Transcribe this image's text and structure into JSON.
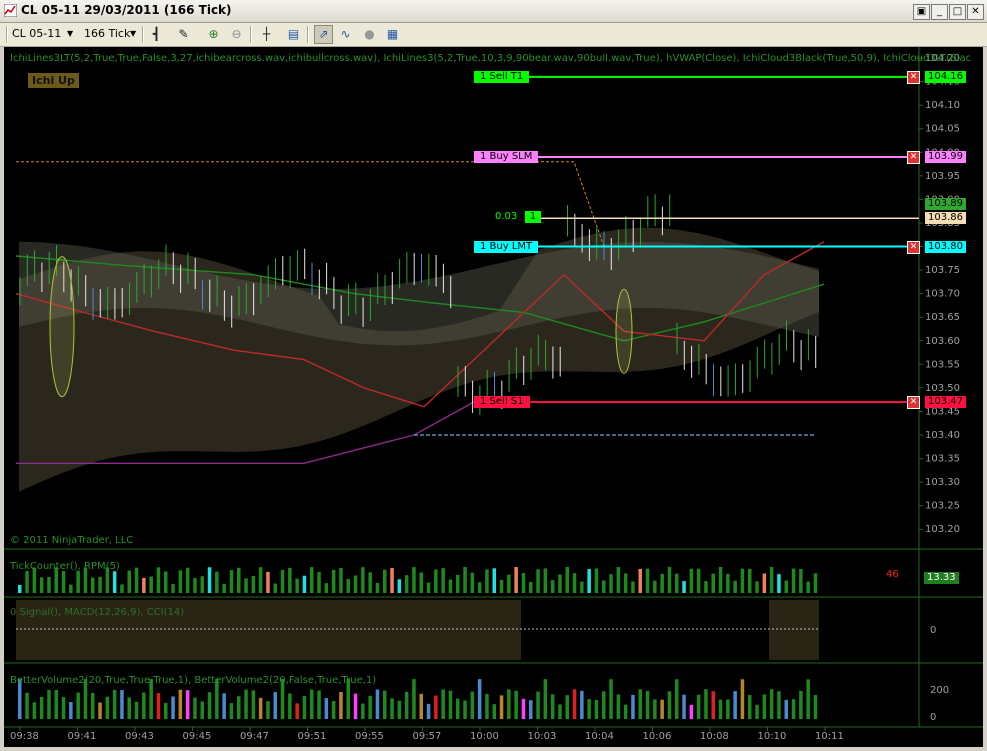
{
  "window": {
    "title": "CL 05-11  29/03/2011 (166 Tick)",
    "buttons": [
      "minimize",
      "maximize",
      "close"
    ]
  },
  "toolbar": {
    "instrument": "CL 05-11",
    "period": "166 Tick"
  },
  "colors": {
    "background": "#000000",
    "axis_text": "#a0a0a0",
    "grid": "#1e4a1e",
    "sell_t1": "#00ff00",
    "buy_slm": "#ff80ff",
    "buy_lmt": "#00ffff",
    "sell_s1": "#ff1040",
    "close_line": "#f5deb3"
  },
  "chart": {
    "indicator_label": "IchiLines3LT(5,2,True,True,False,3,27,ichibearcross.wav,ichibullcross.wav), IchiLines3(5,2,True,10,3,9,90bear.wav,90bull.wav,True), hVWAP(Close), IchiCloud3Black(True,50,9), IchiCloud3LT(Blac",
    "state_badge": "Ichi Up",
    "copyright": "© 2011 NinjaTrader, LLC",
    "price_axis": [
      "104.20",
      "104.15",
      "104.10",
      "104.05",
      "104.00",
      "103.95",
      "103.90",
      "103.85",
      "103.80",
      "103.75",
      "103.70",
      "103.65",
      "103.60",
      "103.55",
      "103.50",
      "103.45",
      "103.40",
      "103.35",
      "103.30",
      "103.25",
      "103.20"
    ],
    "price_range": [
      103.175,
      104.215
    ],
    "pnl_label": "0.03",
    "pnl_qty": "1",
    "orders": [
      {
        "qty": "1",
        "label": "Sell T1",
        "price": "104.16",
        "color": "#00ff00",
        "value": 104.16
      },
      {
        "qty": "1",
        "label": "Buy SLM",
        "price": "103.99",
        "color": "#ff80ff",
        "value": 103.99
      },
      {
        "qty": "1",
        "label": "Buy LMT",
        "price": "103.80",
        "color": "#00ffff",
        "value": 103.8
      },
      {
        "qty": "1",
        "label": "Sell S1",
        "price": "103.47",
        "color": "#ff1040",
        "value": 103.47
      }
    ],
    "last_price": "103.89",
    "close_price": "103.86"
  },
  "panel_tick": {
    "label": "TickCounter(), RPM(5)",
    "value": "13.33",
    "counter": "46"
  },
  "panel_osc": {
    "label": "0  Signal(),  MACD(12,26,9),  CCI(14)",
    "zero": "0"
  },
  "panel_volume": {
    "label": "BetterVolume2(20,True,True,True,1), BetterVolume2(20,False,True,True,1)",
    "axis": [
      "200",
      "0"
    ]
  },
  "time_axis": [
    "09:38",
    "09:41",
    "09:43",
    "09:45",
    "09:47",
    "09:51",
    "09:55",
    "09:57",
    "10:00",
    "10:03",
    "10:04",
    "10:06",
    "10:08",
    "10:10",
    "10:11"
  ]
}
